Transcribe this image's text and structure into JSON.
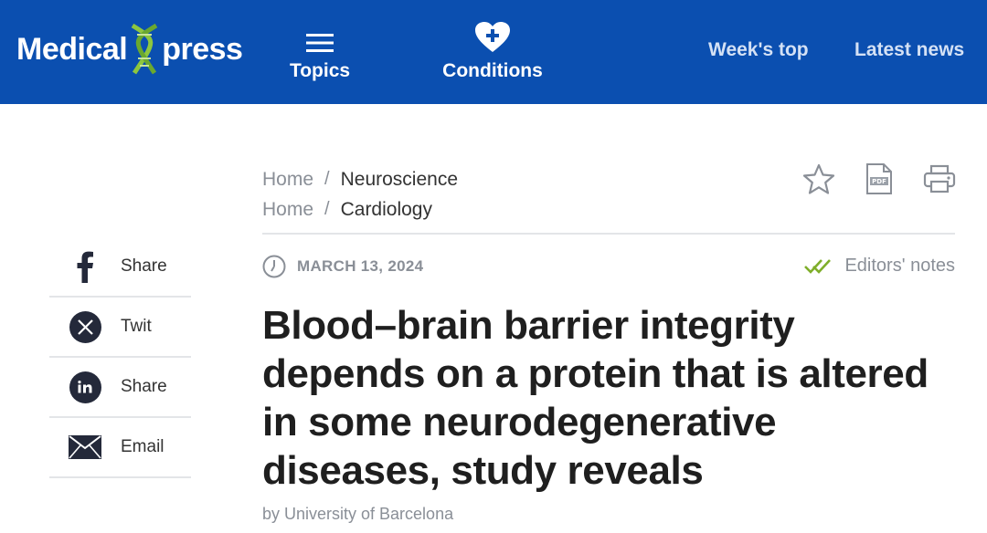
{
  "header": {
    "logo_left": "Medical",
    "logo_right": "press",
    "nav": {
      "topics": "Topics",
      "conditions": "Conditions",
      "weeks_top": "Week's top",
      "latest_news": "Latest news"
    },
    "icons": {
      "topics": "hamburger-menu-icon",
      "conditions": "heart-plus-icon"
    },
    "colors": {
      "bar": "#0b4fb0",
      "dna_accent": "#8dc63f"
    }
  },
  "breadcrumbs": [
    {
      "home": "Home",
      "separator": "/",
      "category": "Neuroscience"
    },
    {
      "home": "Home",
      "separator": "/",
      "category": "Cardiology"
    }
  ],
  "tools": [
    "star-icon",
    "pdf-icon",
    "print-icon"
  ],
  "meta": {
    "date": "MARCH 13, 2024",
    "editors_notes": "Editors' notes"
  },
  "article": {
    "headline": "Blood–brain barrier integrity depends on a protein that is altered in some neurodegenerative diseases, study reveals",
    "byline": "by University of Barcelona"
  },
  "share": [
    {
      "label": "Share",
      "icon": "facebook-icon"
    },
    {
      "label": "Twit",
      "icon": "x-icon"
    },
    {
      "label": "Share",
      "icon": "linkedin-icon"
    },
    {
      "label": "Email",
      "icon": "envelope-icon"
    }
  ]
}
